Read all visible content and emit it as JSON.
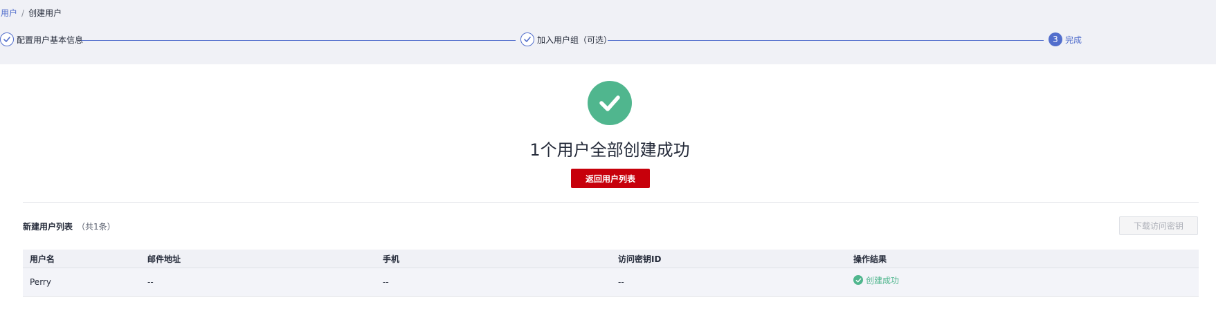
{
  "breadcrumb": {
    "parent": "用户",
    "separator": "/",
    "current": "创建用户"
  },
  "steps": [
    {
      "label": "配置用户基本信息",
      "state": "done"
    },
    {
      "label": "加入用户组（可选）",
      "state": "done"
    },
    {
      "number": "3",
      "label": "完成",
      "state": "active"
    }
  ],
  "result": {
    "title": "1个用户全部创建成功",
    "return_button": "返回用户列表"
  },
  "list": {
    "title": "新建用户列表",
    "count": "（共1条）",
    "download_button": "下载访问密钥",
    "columns": [
      "用户名",
      "邮件地址",
      "手机",
      "访问密钥ID",
      "操作结果"
    ],
    "rows": [
      {
        "username": "Perry",
        "email": "--",
        "phone": "--",
        "access_key_id": "--",
        "result": "创建成功"
      }
    ]
  },
  "colors": {
    "accent": "#526ecc",
    "success": "#50b68e",
    "primary_button": "#c7000b"
  }
}
